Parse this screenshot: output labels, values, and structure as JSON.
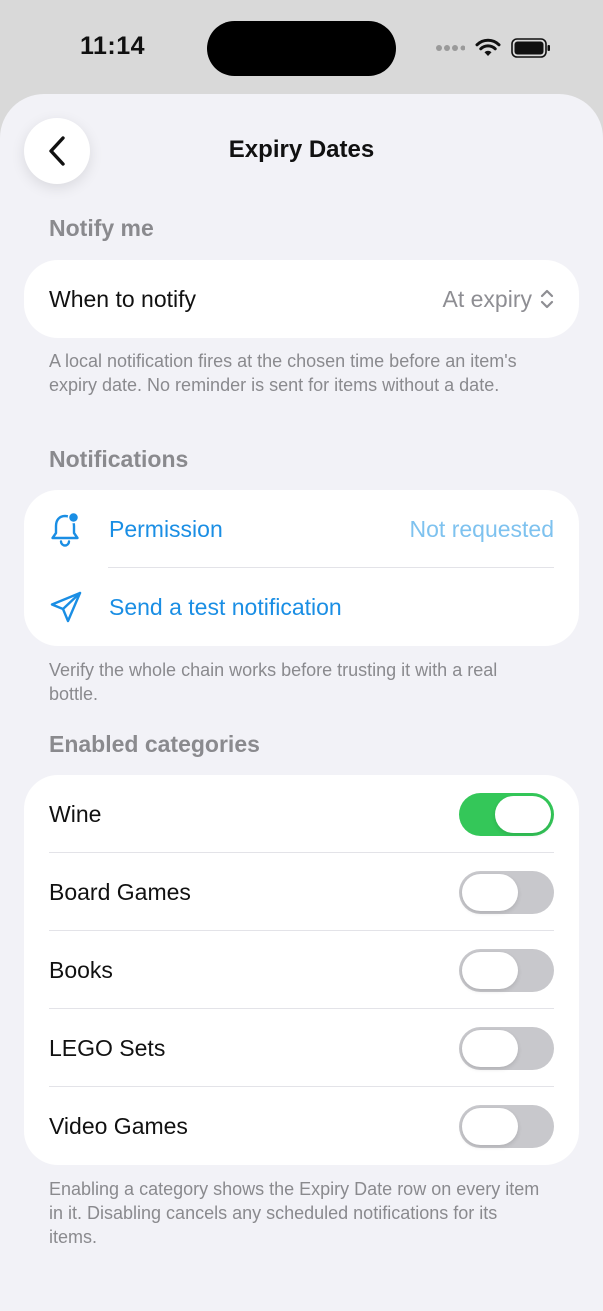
{
  "status_bar": {
    "time": "11:14"
  },
  "nav": {
    "title": "Expiry Dates",
    "back_icon": "chevron-left-icon"
  },
  "notify_section": {
    "header": "Notify me",
    "row_label": "When to notify",
    "row_value": "At expiry",
    "footer": "A local notification fires at the chosen time before an item's expiry date. No reminder is sent for items without a date."
  },
  "notifications_section": {
    "header": "Notifications",
    "permission_label": "Permission",
    "permission_value": "Not requested",
    "test_label": "Send a test notification",
    "footer": "Verify the whole chain works before trusting it with a real bottle."
  },
  "categories_section": {
    "header": "Enabled categories",
    "items": [
      {
        "label": "Wine",
        "enabled": true
      },
      {
        "label": "Board Games",
        "enabled": false
      },
      {
        "label": "Books",
        "enabled": false
      },
      {
        "label": "LEGO Sets",
        "enabled": false
      },
      {
        "label": "Video Games",
        "enabled": false
      }
    ],
    "footer": "Enabling a category shows the Expiry Date row on every item in it. Disabling cancels any scheduled notifications for its items."
  },
  "colors": {
    "accent": "#1a8ee4",
    "toggle_on": "#34c759",
    "toggle_off": "#c8c8cc",
    "background": "#f2f2f7"
  }
}
